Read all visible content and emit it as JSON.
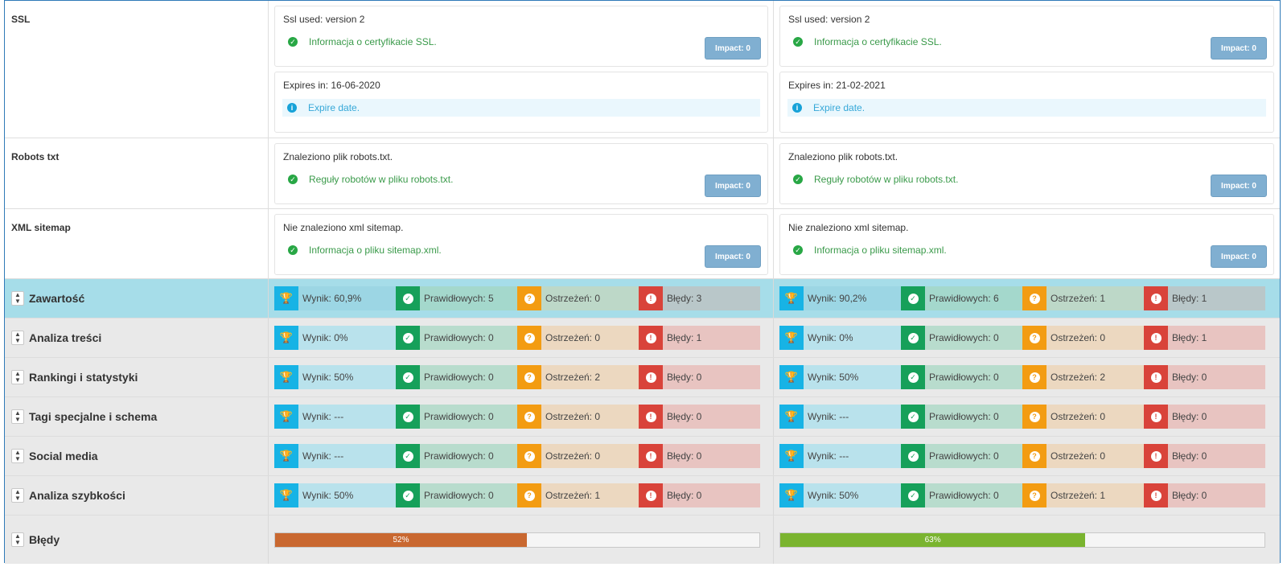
{
  "rows": {
    "ssl": {
      "label": "SSL",
      "cols": [
        {
          "version_text": "Ssl used: version 2",
          "version_msg": "Informacja o certyfikacie SSL.",
          "impact": "Impact: 0",
          "expires_text": "Expires in: 16-06-2020",
          "expires_msg": "Expire date."
        },
        {
          "version_text": "Ssl used: version 2",
          "version_msg": "Informacja o certyfikacie SSL.",
          "impact": "Impact: 0",
          "expires_text": "Expires in: 21-02-2021",
          "expires_msg": "Expire date."
        }
      ]
    },
    "robots": {
      "label": "Robots txt",
      "cols": [
        {
          "text": "Znaleziono plik robots.txt.",
          "msg": "Reguły robotów w pliku robots.txt.",
          "impact": "Impact: 0"
        },
        {
          "text": "Znaleziono plik robots.txt.",
          "msg": "Reguły robotów w pliku robots.txt.",
          "impact": "Impact: 0"
        }
      ]
    },
    "sitemap": {
      "label": "XML sitemap",
      "cols": [
        {
          "text": "Nie znaleziono xml sitemap.",
          "msg": "Informacja o pliku sitemap.xml.",
          "impact": "Impact: 0"
        },
        {
          "text": "Nie znaleziono xml sitemap.",
          "msg": "Informacja o pliku sitemap.xml.",
          "impact": "Impact: 0"
        }
      ]
    }
  },
  "sections": [
    {
      "label": "Zawartość",
      "cols": [
        {
          "score": "Wynik: 60,9%",
          "valid": "Prawidłowych: 5",
          "warn": "Ostrzeżeń: 0",
          "err": "Błędy: 3"
        },
        {
          "score": "Wynik: 90,2%",
          "valid": "Prawidłowych: 6",
          "warn": "Ostrzeżeń: 1",
          "err": "Błędy: 1"
        }
      ]
    },
    {
      "label": "Analiza treści",
      "cols": [
        {
          "score": "Wynik: 0%",
          "valid": "Prawidłowych: 0",
          "warn": "Ostrzeżeń: 0",
          "err": "Błędy: 1"
        },
        {
          "score": "Wynik: 0%",
          "valid": "Prawidłowych: 0",
          "warn": "Ostrzeżeń: 0",
          "err": "Błędy: 1"
        }
      ]
    },
    {
      "label": "Rankingi i statystyki",
      "cols": [
        {
          "score": "Wynik: 50%",
          "valid": "Prawidłowych: 0",
          "warn": "Ostrzeżeń: 2",
          "err": "Błędy: 0"
        },
        {
          "score": "Wynik: 50%",
          "valid": "Prawidłowych: 0",
          "warn": "Ostrzeżeń: 2",
          "err": "Błędy: 0"
        }
      ]
    },
    {
      "label": "Tagi specjalne i schema",
      "cols": [
        {
          "score": "Wynik: ---",
          "valid": "Prawidłowych: 0",
          "warn": "Ostrzeżeń: 0",
          "err": "Błędy: 0"
        },
        {
          "score": "Wynik: ---",
          "valid": "Prawidłowych: 0",
          "warn": "Ostrzeżeń: 0",
          "err": "Błędy: 0"
        }
      ]
    },
    {
      "label": "Social media",
      "cols": [
        {
          "score": "Wynik: ---",
          "valid": "Prawidłowych: 0",
          "warn": "Ostrzeżeń: 0",
          "err": "Błędy: 0"
        },
        {
          "score": "Wynik: ---",
          "valid": "Prawidłowych: 0",
          "warn": "Ostrzeżeń: 0",
          "err": "Błędy: 0"
        }
      ]
    },
    {
      "label": "Analiza szybkości",
      "cols": [
        {
          "score": "Wynik: 50%",
          "valid": "Prawidłowych: 0",
          "warn": "Ostrzeżeń: 1",
          "err": "Błędy: 0"
        },
        {
          "score": "Wynik: 50%",
          "valid": "Prawidłowych: 0",
          "warn": "Ostrzeżeń: 1",
          "err": "Błędy: 0"
        }
      ]
    }
  ],
  "errors_row": {
    "label": "Błędy",
    "bars": [
      {
        "percent": 52,
        "text": "52%",
        "color": "#c96830"
      },
      {
        "percent": 63,
        "text": "63%",
        "color": "#7ab42f"
      }
    ]
  },
  "icons": {
    "score": "trophy-icon",
    "valid": "check-circle-icon",
    "warn": "question-circle-icon",
    "err": "exclamation-circle-icon",
    "ok_msg": "check-circle-icon",
    "info_msg": "info-circle-icon",
    "sort": "sort-icon"
  }
}
